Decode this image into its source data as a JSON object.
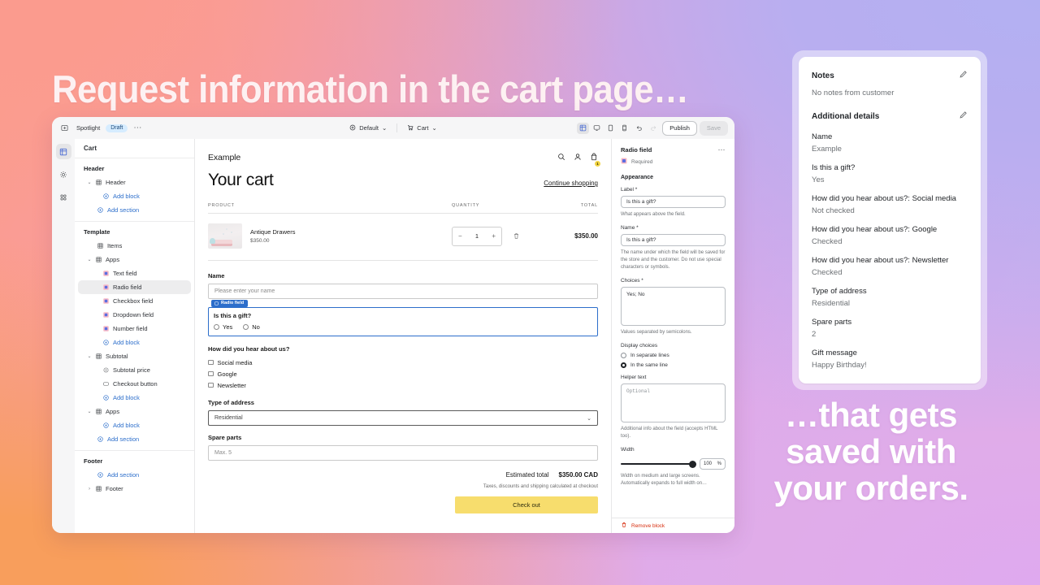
{
  "headline": "Request information in the cart page…",
  "tagline": "…that gets saved with your orders.",
  "colors": {
    "accent_blue": "#2c6ecb",
    "checkout_yellow": "#f7dd6d",
    "remove_red": "#d72c0d"
  },
  "topbar": {
    "back_icon": "back-arrow-icon",
    "app_name": "Spotlight",
    "status_badge": "Draft",
    "more_icon": "ellipsis-icon",
    "theme_selector": "Default",
    "page_selector": "Cart",
    "devices": [
      "sections-icon",
      "desktop-icon",
      "tablet-icon",
      "mobile-icon"
    ],
    "undo_icon": "undo-icon",
    "redo_icon": "redo-icon",
    "publish_label": "Publish",
    "save_label": "Save"
  },
  "rail": {
    "items": [
      "sections-icon",
      "settings-gear-icon",
      "apps-icon"
    ]
  },
  "sidebar": {
    "header_title": "Cart",
    "groups": [
      {
        "label": "Header",
        "rows": [
          {
            "text": "Header",
            "type": "section",
            "caret": "⌄",
            "icon": "grid-icon",
            "indent": 1
          },
          {
            "text": "Add block",
            "type": "add",
            "icon": "plus-circle-icon",
            "indent": 3
          },
          {
            "text": "Add section",
            "type": "add",
            "icon": "plus-circle-icon",
            "indent": 2
          }
        ]
      },
      {
        "label": "Template",
        "rows": [
          {
            "text": "Items",
            "type": "section",
            "caret": "",
            "icon": "grid-icon",
            "indent": 2
          },
          {
            "text": "Apps",
            "type": "section",
            "caret": "⌄",
            "icon": "grid-icon",
            "indent": 1
          },
          {
            "text": "Text field",
            "type": "block",
            "icon": "app-block-icon",
            "indent": 3
          },
          {
            "text": "Radio field",
            "type": "block",
            "icon": "app-block-icon",
            "indent": 3,
            "selected": true
          },
          {
            "text": "Checkbox field",
            "type": "block",
            "icon": "app-block-icon",
            "indent": 3
          },
          {
            "text": "Dropdown field",
            "type": "block",
            "icon": "app-block-icon",
            "indent": 3
          },
          {
            "text": "Number field",
            "type": "block",
            "icon": "app-block-icon",
            "indent": 3
          },
          {
            "text": "Add block",
            "type": "add",
            "icon": "plus-circle-icon",
            "indent": 3
          },
          {
            "text": "Subtotal",
            "type": "section",
            "caret": "⌄",
            "icon": "grid-icon",
            "indent": 1
          },
          {
            "text": "Subtotal price",
            "type": "block",
            "icon": "price-icon",
            "indent": 3
          },
          {
            "text": "Checkout button",
            "type": "block",
            "icon": "button-icon",
            "indent": 3
          },
          {
            "text": "Add block",
            "type": "add",
            "icon": "plus-circle-icon",
            "indent": 3
          },
          {
            "text": "Apps",
            "type": "section",
            "caret": "⌄",
            "icon": "grid-icon",
            "indent": 1
          },
          {
            "text": "Add block",
            "type": "add",
            "icon": "plus-circle-icon",
            "indent": 3
          },
          {
            "text": "Add section",
            "type": "add",
            "icon": "plus-circle-icon",
            "indent": 2
          }
        ]
      },
      {
        "label": "Footer",
        "rows": [
          {
            "text": "Add section",
            "type": "add",
            "icon": "plus-circle-icon",
            "indent": 2
          },
          {
            "text": "Footer",
            "type": "section",
            "caret": "›",
            "icon": "grid-icon",
            "indent": 1
          }
        ]
      }
    ]
  },
  "preview": {
    "brand": "Example",
    "page_title": "Your cart",
    "continue_link": "Continue shopping",
    "columns": {
      "product": "PRODUCT",
      "quantity": "QUANTITY",
      "total": "TOTAL"
    },
    "cart_badge_count": "1",
    "line_item": {
      "name": "Antique Drawers",
      "price": "$350.00",
      "quantity": "1",
      "minus": "−",
      "plus": "+",
      "total": "$350.00"
    },
    "form": {
      "name_label": "Name",
      "name_placeholder": "Please enter your name",
      "selected_block_tag": "Radio field",
      "gift_label": "Is this a gift?",
      "gift_options": [
        "Yes",
        "No"
      ],
      "hear_label": "How did you hear about us?",
      "hear_options": [
        "Social media",
        "Google",
        "Newsletter"
      ],
      "address_label": "Type of address",
      "address_value": "Residential",
      "spare_label": "Spare parts",
      "spare_placeholder": "Max. 5"
    },
    "totals": {
      "estimated_label": "Estimated total",
      "estimated_value": "$350.00 CAD",
      "note": "Taxes, discounts and shipping calculated at checkout",
      "checkout_label": "Check out"
    }
  },
  "settings": {
    "title": "Radio field",
    "required_label": "Required",
    "appearance_heading": "Appearance",
    "label_field_label": "Label *",
    "label_field_value": "Is this a gift?",
    "label_help": "What appears above the field.",
    "name_field_label": "Name *",
    "name_field_value": "Is this a gift?",
    "name_help": "The name under which the field will be saved for the store and the customer. Do not use special characters or symbols.",
    "choices_label": "Choices *",
    "choices_value": "Yes; No",
    "choices_help": "Values separated by semicolons.",
    "display_choices_label": "Display choices",
    "display_options": [
      "In separate lines",
      "In the same line"
    ],
    "display_selected": "In the same line",
    "helper_text_label": "Helper text",
    "helper_text_placeholder": "Optional",
    "helper_text_help": "Additional info about the field (accepts HTML too).",
    "width_label": "Width",
    "width_value": "100",
    "width_unit": "%",
    "width_help": "Width on medium and large screens. Automatically expands to full width on…",
    "remove_label": "Remove block"
  },
  "notes": {
    "title": "Notes",
    "empty": "No notes from customer",
    "details_title": "Additional details",
    "edit_icon": "pencil-icon",
    "items": [
      {
        "key": "Name",
        "value": "Example"
      },
      {
        "key": "Is this a gift?",
        "value": "Yes"
      },
      {
        "key": "How did you hear about us?: Social media",
        "value": "Not checked"
      },
      {
        "key": "How did you hear about us?: Google",
        "value": "Checked"
      },
      {
        "key": "How did you hear about us?: Newsletter",
        "value": "Checked"
      },
      {
        "key": "Type of address",
        "value": "Residential"
      },
      {
        "key": "Spare parts",
        "value": "2"
      },
      {
        "key": "Gift message",
        "value": "Happy Birthday!"
      }
    ]
  }
}
